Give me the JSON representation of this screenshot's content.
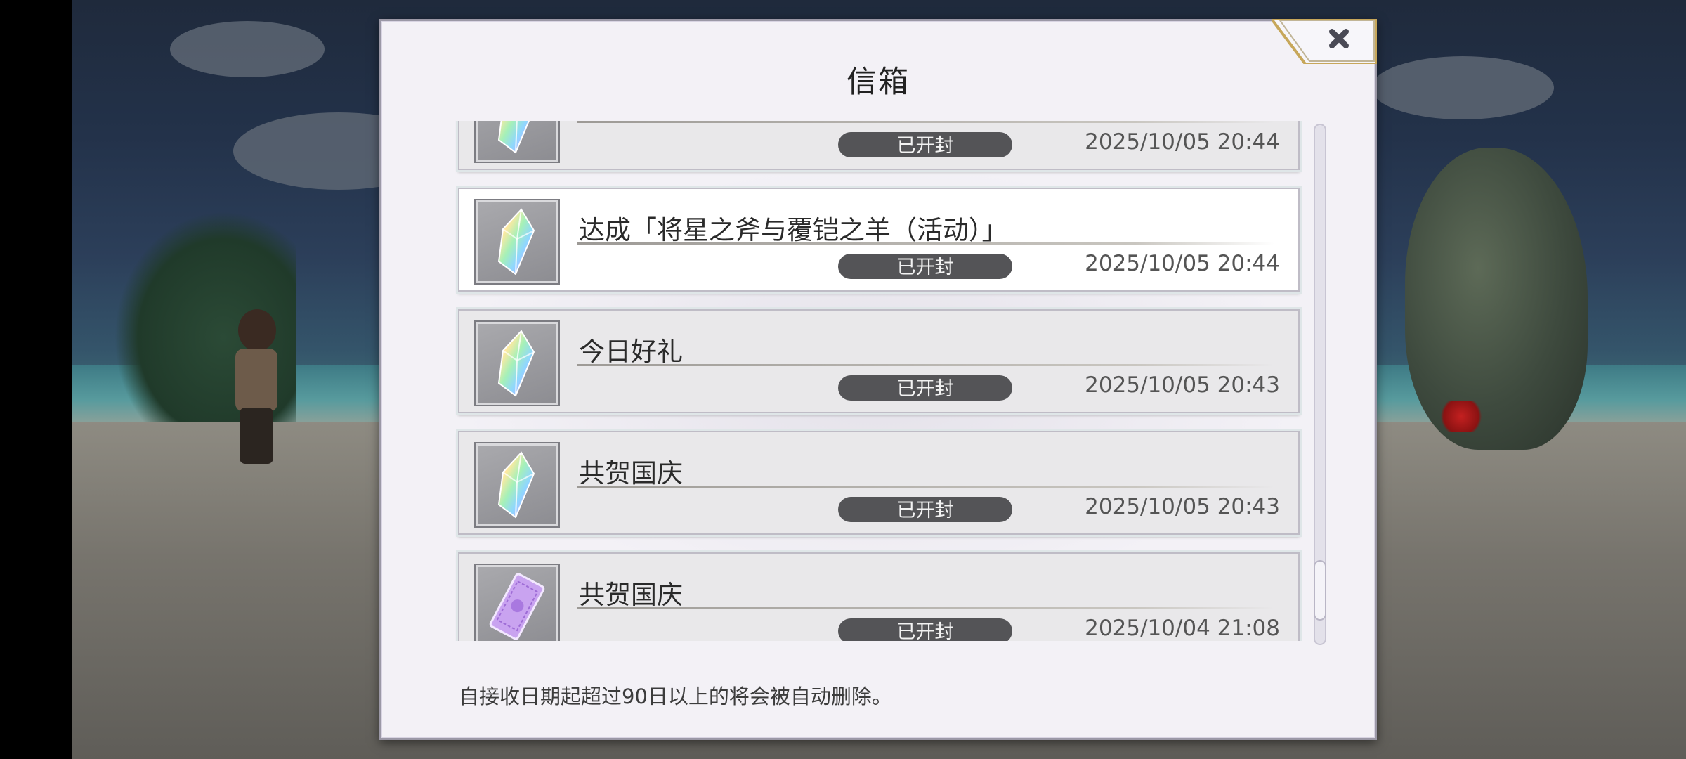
{
  "dialog": {
    "title": "信箱",
    "close_icon": "close-x-icon",
    "footer_note": "自接收日期起超过90日以上的将会被自动删除。"
  },
  "mail": [
    {
      "title": "",
      "status": "已开封",
      "date": "2025/10/05 20:44",
      "icon": "rainbow-crystal-icon",
      "selected": false
    },
    {
      "title": "达成「将星之斧与覆铠之羊（活动）」",
      "status": "已开封",
      "date": "2025/10/05 20:44",
      "icon": "rainbow-crystal-icon",
      "selected": true
    },
    {
      "title": "今日好礼",
      "status": "已开封",
      "date": "2025/10/05 20:43",
      "icon": "rainbow-crystal-icon",
      "selected": false
    },
    {
      "title": "共贺国庆",
      "status": "已开封",
      "date": "2025/10/05 20:43",
      "icon": "rainbow-crystal-icon",
      "selected": false
    },
    {
      "title": "共贺国庆",
      "status": "已开封",
      "date": "2025/10/04 21:08",
      "icon": "purple-ticket-icon",
      "selected": false
    }
  ],
  "scroll": {
    "position": 0.95
  }
}
